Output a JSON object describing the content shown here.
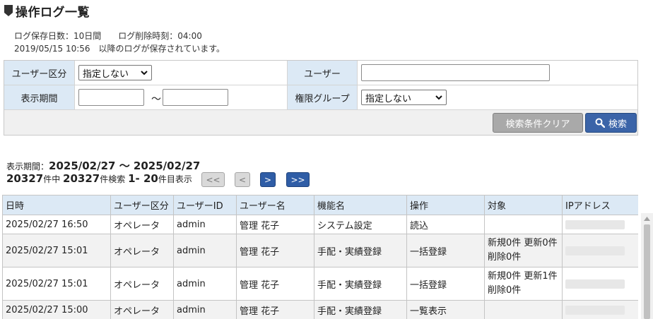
{
  "page": {
    "title": "操作ログ一覧"
  },
  "info": {
    "retention": "ログ保存日数：10日間",
    "delete_time": "ログ削除時刻：04:00",
    "saved_since": "2019/05/15 10:56　以降のログが保存されています。"
  },
  "search": {
    "user_type_label": "ユーザー区分",
    "user_type_value": "指定しない",
    "user_label": "ユーザー",
    "user_value": "",
    "period_label": "表示期間",
    "period_from": "",
    "period_sep": "～",
    "period_to": "",
    "role_group_label": "権限グループ",
    "role_group_value": "指定しない",
    "clear_label": "検索条件クリア",
    "search_label": "検索"
  },
  "results": {
    "period_prefix": "表示期間：",
    "period_value": "2025/02/27 ～ 2025/02/27",
    "total": "20327",
    "total_suffix": "件中",
    "found": "20327",
    "found_suffix": "件検索",
    "range": "1- 20",
    "range_suffix": "件目表示"
  },
  "pager": {
    "first": "<<",
    "prev": "<",
    "next": ">",
    "last": ">>"
  },
  "table": {
    "headers": [
      "日時",
      "ユーザー区分",
      "ユーザーID",
      "ユーザー名",
      "機能名",
      "操作",
      "対象",
      "IPアドレス"
    ],
    "rows": [
      {
        "datetime": "2025/02/27 16:50",
        "user_type": "オペレータ",
        "user_id": "admin",
        "user_name": "管理 花子",
        "function": "システム設定",
        "operation": "読込",
        "target1": "",
        "target2": ""
      },
      {
        "datetime": "2025/02/27 15:01",
        "user_type": "オペレータ",
        "user_id": "admin",
        "user_name": "管理 花子",
        "function": "手配・実績登録",
        "operation": "一括登録",
        "target1": "新規0件 更新0件",
        "target2": "削除0件"
      },
      {
        "datetime": "2025/02/27 15:01",
        "user_type": "オペレータ",
        "user_id": "admin",
        "user_name": "管理 花子",
        "function": "手配・実績登録",
        "operation": "一括登録",
        "target1": "新規0件 更新1件",
        "target2": "削除0件"
      },
      {
        "datetime": "2025/02/27 15:00",
        "user_type": "オペレータ",
        "user_id": "admin",
        "user_name": "管理 花子",
        "function": "手配・実績登録",
        "operation": "一覧表示",
        "target1": "",
        "target2": ""
      }
    ]
  },
  "icons": {
    "title": "shield-icon",
    "search": "search-icon",
    "select": "chevron-down-icon"
  },
  "colors": {
    "label_bg": "#dce9f5",
    "primary_button": "#3b64a8",
    "disabled_button": "#a9a9a9"
  }
}
